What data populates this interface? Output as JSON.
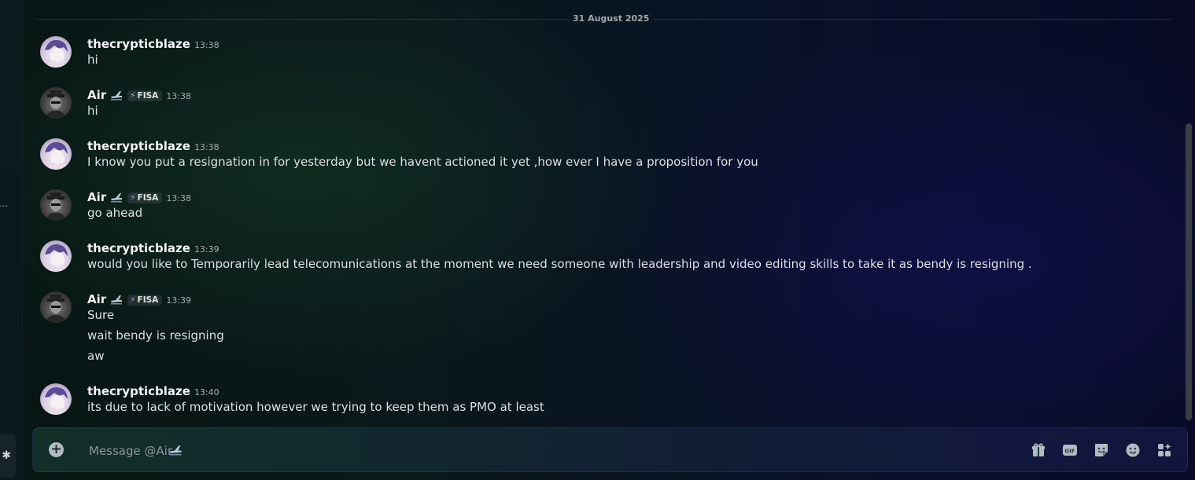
{
  "date_divider": "31 August 2025",
  "messages": [
    {
      "author": "thecrypticblaze",
      "avatar": "anime-avatar",
      "time": "13:38",
      "lines": [
        "hi"
      ]
    },
    {
      "author": "Air",
      "tag": "FISA",
      "avatar": "agent-avatar",
      "time": "13:38",
      "lines": [
        "hi"
      ]
    },
    {
      "author": "thecrypticblaze",
      "avatar": "anime-avatar",
      "time": "13:38",
      "lines": [
        "I know you put a resignation in for yesterday but we havent actioned it yet ,how ever I have a proposition for you"
      ]
    },
    {
      "author": "Air",
      "tag": "FISA",
      "avatar": "agent-avatar",
      "time": "13:38",
      "lines": [
        "go ahead"
      ]
    },
    {
      "author": "thecrypticblaze",
      "avatar": "anime-avatar",
      "time": "13:39",
      "lines": [
        "would you like to Temporarily lead telecomunications at the moment we need someone with leadership and video editing skills to take it as bendy is resigning ."
      ]
    },
    {
      "author": "Air",
      "tag": "FISA",
      "avatar": "agent-avatar",
      "time": "13:39",
      "lines": [
        "Sure",
        "wait bendy is resigning",
        "aw"
      ]
    },
    {
      "author": "thecrypticblaze",
      "avatar": "anime-avatar",
      "time": "13:40",
      "lines": [
        "its due to lack of motivation however we trying to keep them as PMO at least"
      ]
    }
  ],
  "composer": {
    "placeholder": "Message @Air",
    "icons": [
      "gift-icon",
      "gif-icon",
      "sticker-icon",
      "emoji-icon",
      "apps-icon"
    ]
  },
  "colors": {
    "tag_bolt": "#c79bff",
    "username": "#f2f3f5",
    "timestamp": "#a5aab0"
  }
}
